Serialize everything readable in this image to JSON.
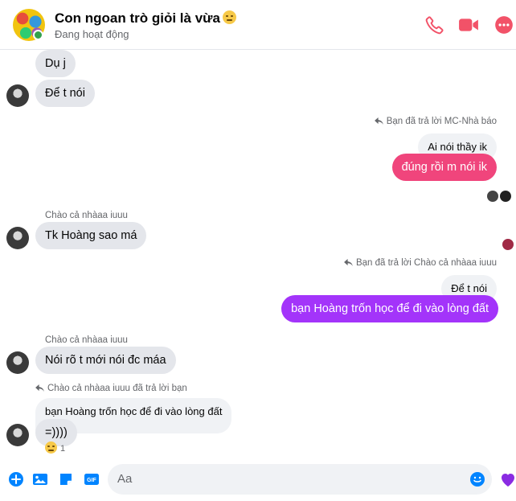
{
  "header": {
    "title": "Con ngoan trò giỏi là vừa",
    "title_emoji": "relieved-face-emoji",
    "status": "Đang hoạt động",
    "actions": [
      "phone-icon",
      "video-icon",
      "more-icon"
    ]
  },
  "messages": {
    "m1": "Dụ j",
    "m2": "Để t nói",
    "m3_meta": "Bạn đã trả lời MC-Nhà báo",
    "m3_quote": "Ai nói thầy ik",
    "m3": "đúng rồi m nói ik",
    "m4_sender": "Chào cả nhàaa iuuu",
    "m4": "Tk Hoàng sao má",
    "m5_meta": "Bạn đã trả lời Chào cả nhàaa iuuu",
    "m5_quote": "Để t nói",
    "m5": "bạn Hoàng trốn học để đi vào lòng đất",
    "m6_sender": "Chào cả nhàaa iuuu",
    "m6": "Nói rõ t mới nói đc máa",
    "m7_meta": "Chào cả nhàaa iuuu đã trả lời bạn",
    "m7_quote": "bạn Hoàng trốn học để đi vào lòng đất",
    "m7": "=))))",
    "m7_reaction_count": "1"
  },
  "composer": {
    "placeholder": "Aa"
  },
  "colors": {
    "accent": "#f0457c",
    "purple": "#a334fa",
    "icon_blue": "#0084ff",
    "icon_red": "#f25268"
  }
}
